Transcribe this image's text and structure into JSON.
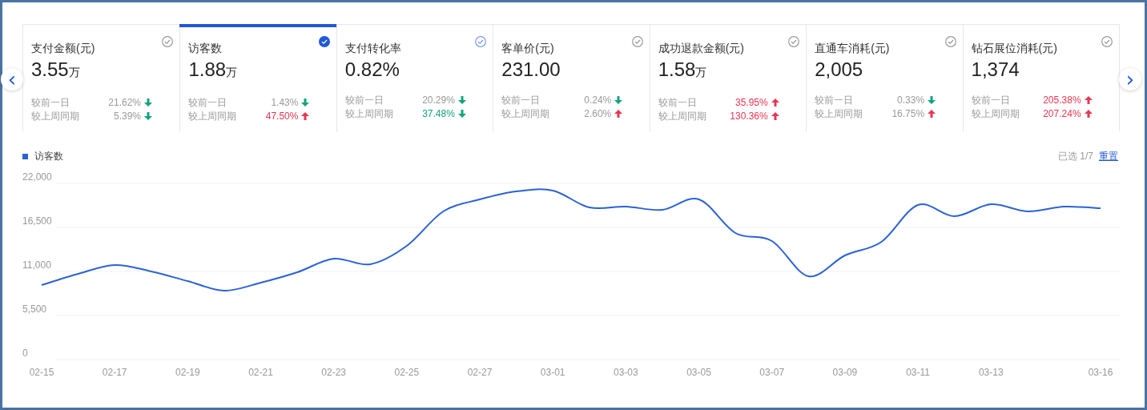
{
  "nav": {
    "prev": "‹",
    "next": "›"
  },
  "metrics": [
    {
      "title": "支付金额(元)",
      "value": "3.55",
      "unit": "万",
      "selected": false,
      "hovered": false,
      "changes": [
        {
          "label": "较前一日",
          "value": "21.62%",
          "kind": "down",
          "emphasized": false
        },
        {
          "label": "较上周同期",
          "value": "5.39%",
          "kind": "down",
          "emphasized": false
        }
      ]
    },
    {
      "title": "访客数",
      "value": "1.88",
      "unit": "万",
      "selected": true,
      "hovered": false,
      "changes": [
        {
          "label": "较前一日",
          "value": "1.43%",
          "kind": "down",
          "emphasized": false
        },
        {
          "label": "较上周同期",
          "value": "47.50%",
          "kind": "up",
          "emphasized": true
        }
      ]
    },
    {
      "title": "支付转化率",
      "value": "0.82%",
      "selected": false,
      "hovered": true,
      "changes": [
        {
          "label": "较前一日",
          "value": "20.29%",
          "kind": "down",
          "emphasized": false
        },
        {
          "label": "较上周同期",
          "value": "37.48%",
          "kind": "down",
          "emphasized": true
        }
      ]
    },
    {
      "title": "客单价(元)",
      "value": "231.00",
      "selected": false,
      "hovered": false,
      "changes": [
        {
          "label": "较前一日",
          "value": "0.24%",
          "kind": "down",
          "emphasized": false
        },
        {
          "label": "较上周同期",
          "value": "2.60%",
          "kind": "up",
          "emphasized": false
        }
      ]
    },
    {
      "title": "成功退款金额(元)",
      "value": "1.58",
      "unit": "万",
      "selected": false,
      "hovered": false,
      "changes": [
        {
          "label": "较前一日",
          "value": "35.95%",
          "kind": "up",
          "emphasized": true
        },
        {
          "label": "较上周同期",
          "value": "130.36%",
          "kind": "up",
          "emphasized": true
        }
      ]
    },
    {
      "title": "直通车消耗(元)",
      "value": "2,005",
      "selected": false,
      "hovered": false,
      "changes": [
        {
          "label": "较前一日",
          "value": "0.33%",
          "kind": "down",
          "emphasized": false
        },
        {
          "label": "较上周同期",
          "value": "16.75%",
          "kind": "up",
          "emphasized": false
        }
      ]
    },
    {
      "title": "钻石展位消耗(元)",
      "value": "1,374",
      "selected": false,
      "hovered": false,
      "changes": [
        {
          "label": "较前一日",
          "value": "205.38%",
          "kind": "up",
          "emphasized": true
        },
        {
          "label": "较上周同期",
          "value": "207.24%",
          "kind": "up",
          "emphasized": true
        }
      ]
    }
  ],
  "chart": {
    "selection": "已选 1/7",
    "reset": "重置",
    "chart_data": {
      "type": "line",
      "categories": [
        "02-15",
        null,
        "02-17",
        null,
        "02-19",
        null,
        "02-21",
        null,
        "02-23",
        null,
        "02-25",
        null,
        "02-27",
        null,
        "03-01",
        null,
        "03-03",
        null,
        "03-05",
        null,
        "03-07",
        null,
        "03-09",
        null,
        "03-11",
        null,
        "03-13",
        null,
        null,
        "03-16"
      ],
      "series": [
        {
          "name": "访客数",
          "color": "#2a62d4",
          "values": [
            9300,
            10700,
            11800,
            11000,
            9800,
            8600,
            9600,
            10900,
            12600,
            11900,
            14200,
            18500,
            20000,
            21000,
            21100,
            19000,
            19100,
            18700,
            20000,
            15800,
            14800,
            10400,
            13000,
            14700,
            19300,
            17900,
            19400,
            18500,
            19100,
            18900
          ]
        }
      ],
      "grid": true,
      "ylim": [
        0,
        22000
      ],
      "yticks": [
        {
          "value": 0,
          "label": "0"
        },
        {
          "value": 5500,
          "label": "5,500"
        },
        {
          "value": 11000,
          "label": "11,000"
        },
        {
          "value": 16500,
          "label": "16,500"
        },
        {
          "value": 22000,
          "label": "22,000"
        }
      ]
    }
  }
}
